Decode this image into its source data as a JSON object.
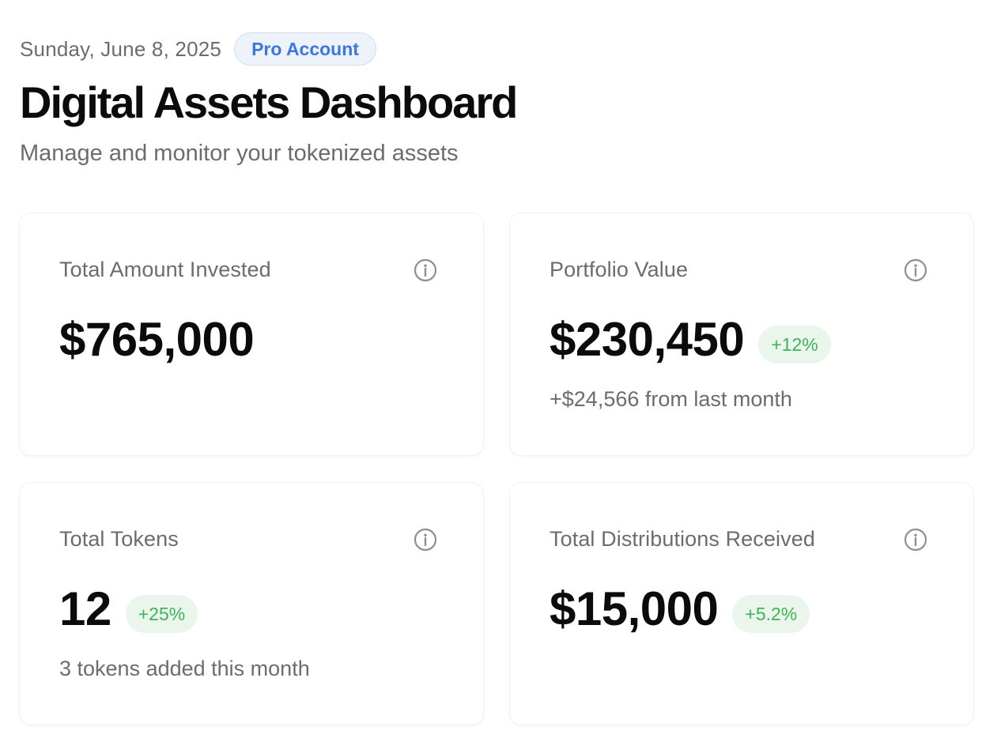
{
  "header": {
    "date": "Sunday, June 8, 2025",
    "account_badge": "Pro Account",
    "title": "Digital Assets Dashboard",
    "subtitle": "Manage and monitor your tokenized assets"
  },
  "cards": [
    {
      "label": "Total Amount Invested",
      "value": "$765,000",
      "icon": "info-icon"
    },
    {
      "label": "Portfolio Value",
      "value": "$230,450",
      "delta": "+12%",
      "note": "+$24,566 from last month",
      "icon": "info-icon"
    },
    {
      "label": "Total Tokens",
      "value": "12",
      "delta": "+25%",
      "note": "3 tokens added this month",
      "icon": "info-icon"
    },
    {
      "label": "Total Distributions Received",
      "value": "$15,000",
      "delta": "+5.2%",
      "icon": "info-icon"
    }
  ],
  "colors": {
    "accent_blue": "#3a77e0",
    "positive_green": "#3fb25a",
    "muted_text": "#6b6b72"
  }
}
